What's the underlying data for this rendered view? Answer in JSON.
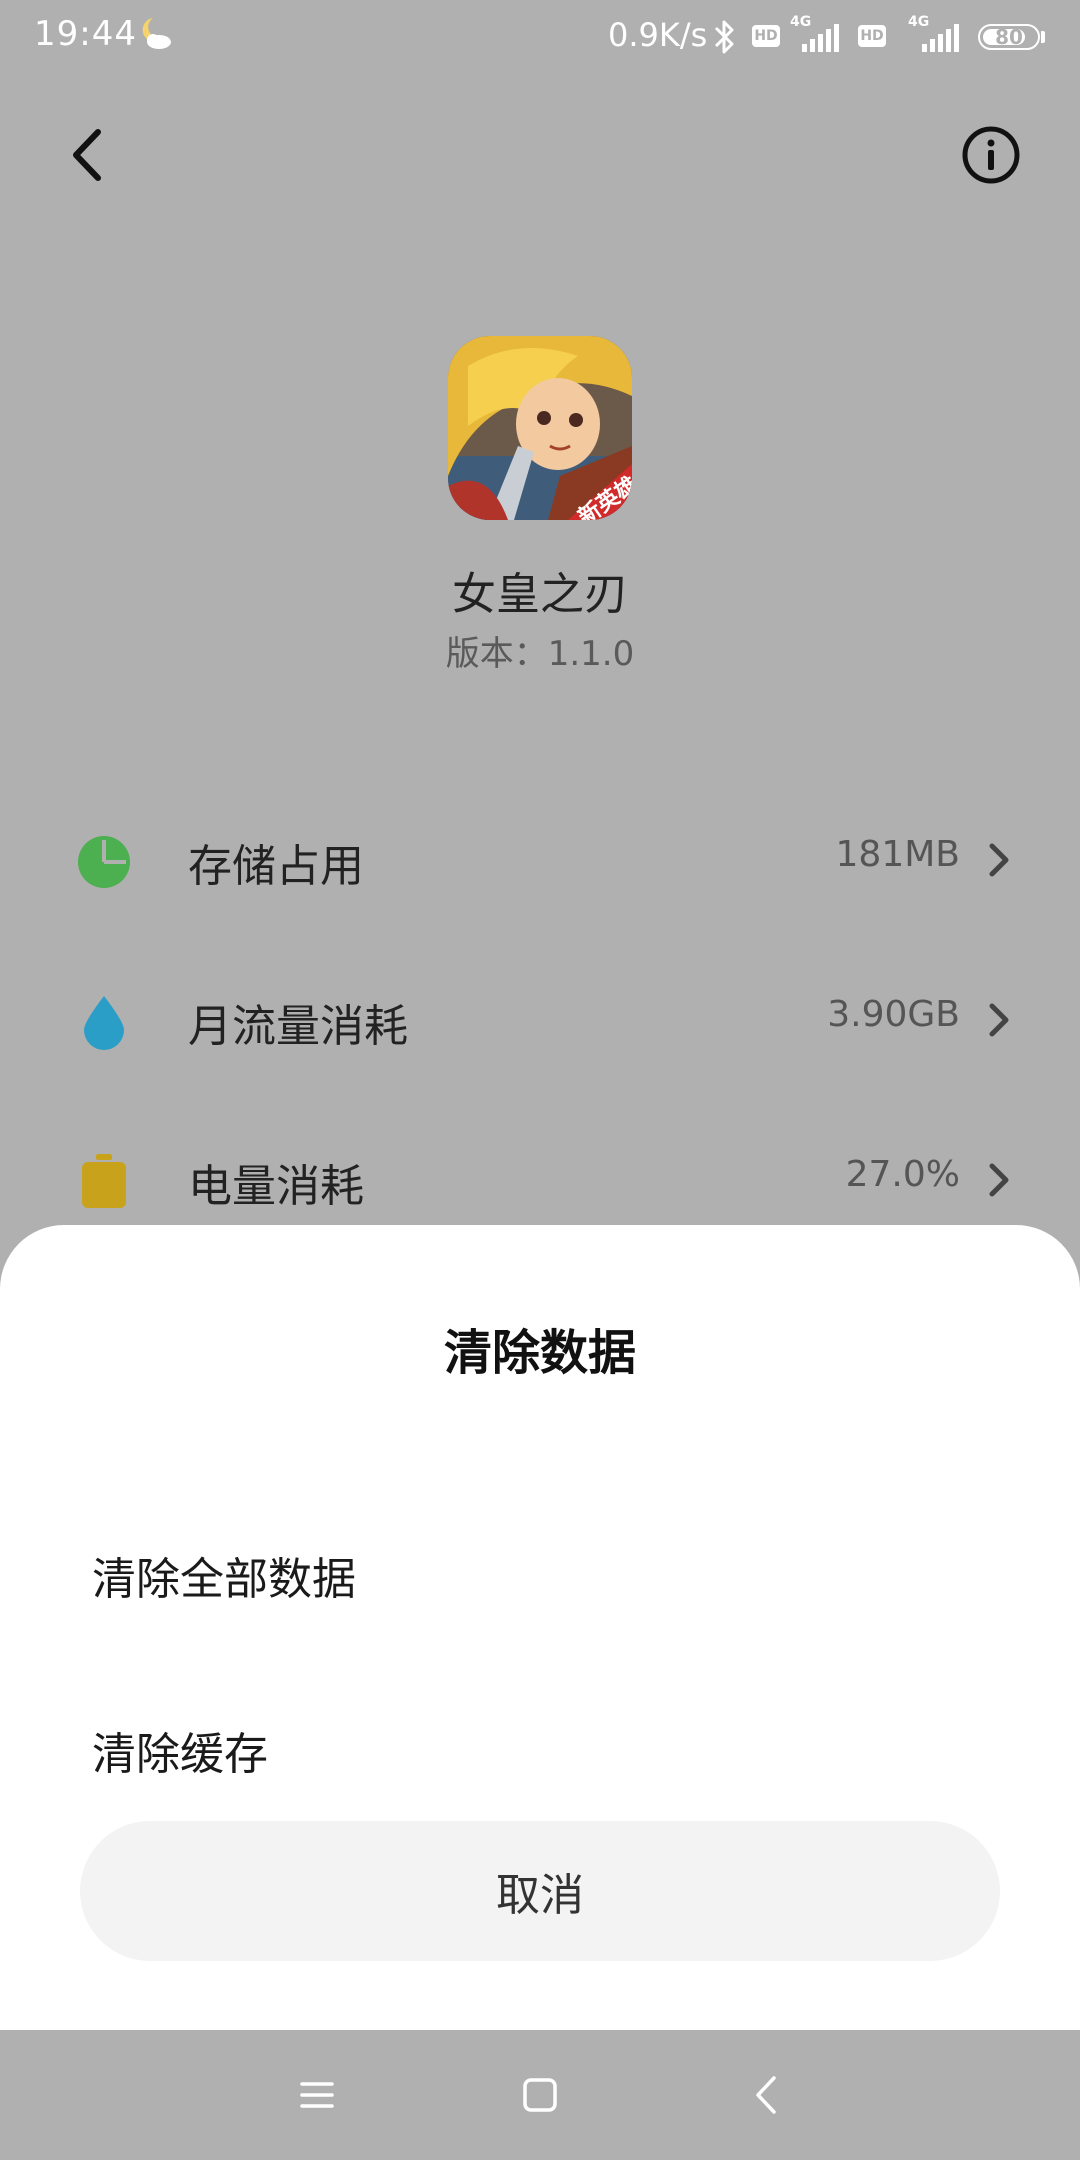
{
  "status_bar": {
    "time": "19:44",
    "weather_icon": "crescent-moon-cloud-icon",
    "net_speed": "0.9K/s",
    "bluetooth_icon": "bluetooth-icon",
    "sim1": {
      "hd": "HD",
      "type": "4G"
    },
    "sim2": {
      "hd": "HD",
      "type": "4G"
    },
    "battery": "80",
    "battery_level_percent": 80
  },
  "top_bar": {
    "back_icon": "chevron-left-icon",
    "info_icon": "info-circle-icon"
  },
  "app": {
    "name": "女皇之刃",
    "version": "版本：1.1.0",
    "icon": "game-app-icon",
    "icon_badge": "新英雄"
  },
  "stats": [
    {
      "label": "存储占用",
      "value": "181MB",
      "icon": "pie-chart-icon",
      "color": "#4caf50"
    },
    {
      "label": "月流量消耗",
      "value": "3.90GB",
      "icon": "water-drop-icon",
      "color": "#2a9ec6"
    },
    {
      "label": "电量消耗",
      "value": "27.0%",
      "icon": "battery-icon",
      "color": "#c9a21b"
    }
  ],
  "sheet": {
    "title": "清除数据",
    "options": [
      "清除全部数据",
      "清除缓存"
    ],
    "cancel": "取消"
  },
  "nav_bar": {
    "menu_icon": "menu-icon",
    "home_icon": "home-square-icon",
    "back_icon": "back-triangle-icon"
  },
  "colors": {
    "dim_background": "#b0b0b0",
    "sheet_background": "#ffffff",
    "cancel_button": "#f3f3f3"
  }
}
